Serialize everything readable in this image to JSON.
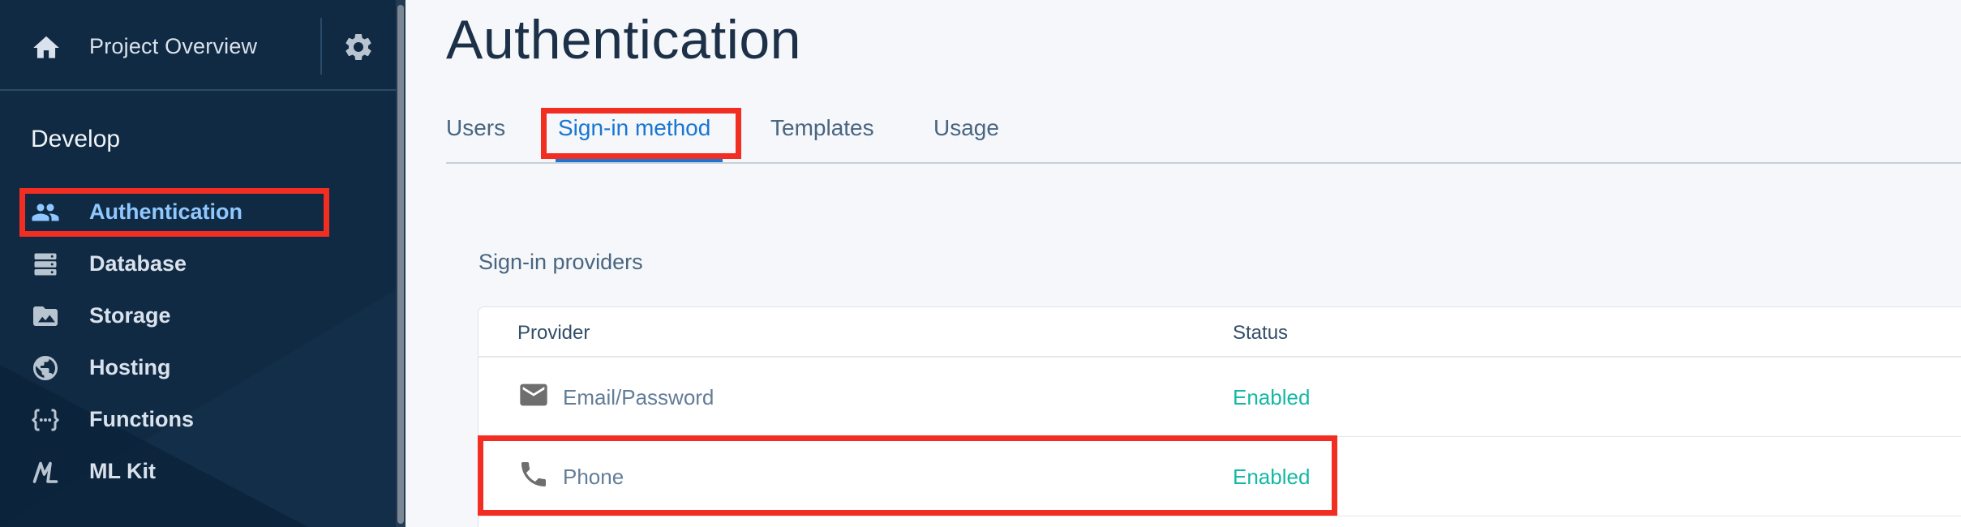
{
  "sidebar": {
    "project_label": "Project Overview",
    "section_title": "Develop",
    "items": [
      {
        "label": "Authentication",
        "icon": "people-icon",
        "active": true
      },
      {
        "label": "Database",
        "icon": "database-icon"
      },
      {
        "label": "Storage",
        "icon": "folder-image-icon"
      },
      {
        "label": "Hosting",
        "icon": "globe-icon"
      },
      {
        "label": "Functions",
        "icon": "functions-icon"
      },
      {
        "label": "ML Kit",
        "icon": "ml-kit-icon"
      }
    ]
  },
  "main": {
    "title": "Authentication",
    "tabs": [
      {
        "label": "Users"
      },
      {
        "label": "Sign-in method",
        "active": true
      },
      {
        "label": "Templates"
      },
      {
        "label": "Usage"
      }
    ],
    "section_label": "Sign-in providers",
    "table": {
      "headers": [
        "Provider",
        "Status"
      ],
      "rows": [
        {
          "provider": "Email/Password",
          "status": "Enabled",
          "icon": "mail-icon"
        },
        {
          "provider": "Phone",
          "status": "Enabled",
          "icon": "phone-icon"
        }
      ]
    }
  },
  "colors": {
    "sidebar_bg": "#102a43",
    "accent": "#1976d2",
    "active_nav": "#8fc8ff",
    "enabled": "#14b8a6",
    "highlight": "#f22d22"
  }
}
